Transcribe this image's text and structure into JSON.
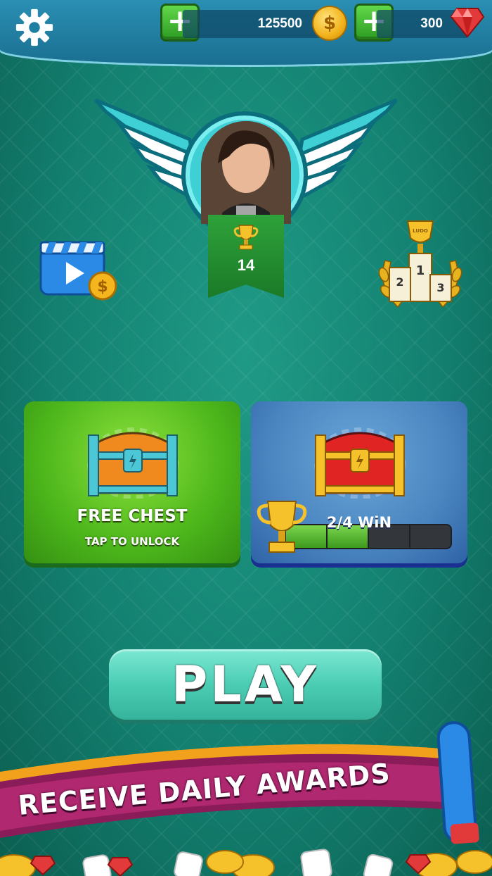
{
  "header": {
    "coins": "125500",
    "gems": "300",
    "coin_symbol": "$"
  },
  "profile": {
    "trophies": "14"
  },
  "cards": {
    "free_chest": {
      "title": "FREE CHEST",
      "subtitle": "TAP TO UNLOCK"
    },
    "win_chest": {
      "title": "2/4 WiN",
      "progress": 0.5,
      "segments": 4,
      "filled": 2
    }
  },
  "play_button": {
    "label": "PLAY"
  },
  "banner": {
    "text": "RECEIVE DAILY AWARDS"
  },
  "leaderboard_icon": {
    "podium_1": "1",
    "podium_2": "2",
    "podium_3": "3",
    "cup_text": "LUDO"
  },
  "colors": {
    "accent_green": "#2c9a22",
    "play_teal": "#4bcdb4",
    "banner_magenta": "#8a1c5a"
  }
}
